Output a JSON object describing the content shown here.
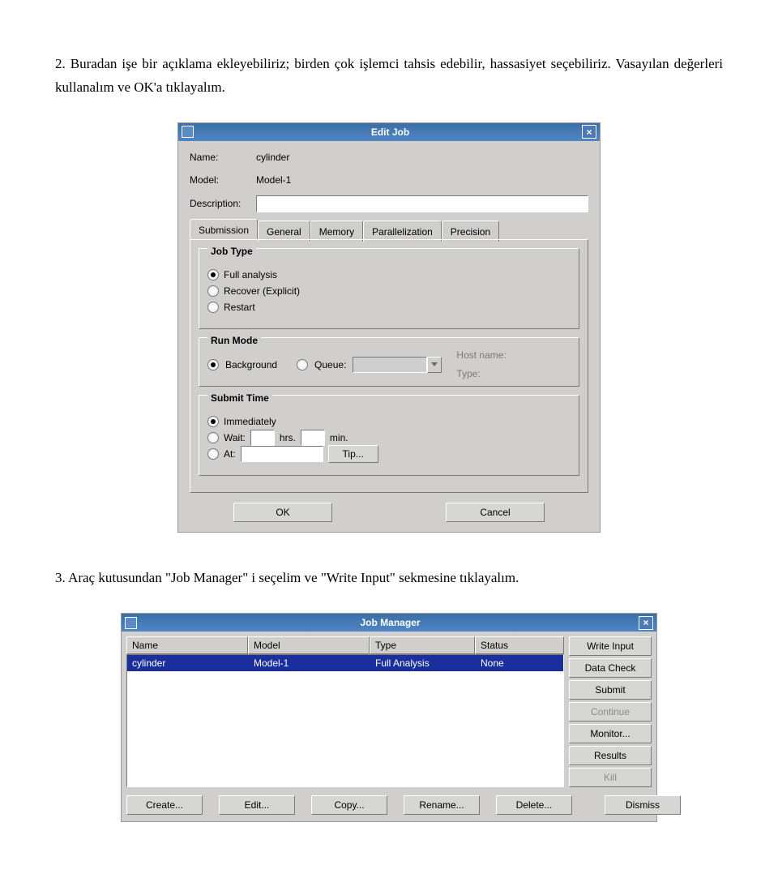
{
  "para1": "2. Buradan işe bir açıklama ekleyebiliriz; birden çok işlemci tahsis edebilir, hassasiyet seçebiliriz. Vasayılan değerleri kullanalım ve OK'a tıklayalım.",
  "para2": "3. Araç kutusundan \"Job Manager\" i seçelim ve \"Write Input\" sekmesine tıklayalım.",
  "editjob": {
    "title": "Edit Job",
    "name_lbl": "Name:",
    "name_val": "cylinder",
    "model_lbl": "Model:",
    "model_val": "Model-1",
    "desc_lbl": "Description:",
    "desc_val": "",
    "tabs": [
      "Submission",
      "General",
      "Memory",
      "Parallelization",
      "Precision"
    ],
    "jobtype": {
      "legend": "Job Type",
      "opt1": "Full analysis",
      "opt2": "Recover (Explicit)",
      "opt3": "Restart"
    },
    "runmode": {
      "legend": "Run Mode",
      "opt_bg": "Background",
      "opt_q": "Queue:",
      "host_lbl": "Host name:",
      "type_lbl": "Type:"
    },
    "submittime": {
      "legend": "Submit Time",
      "opt_imm": "Immediately",
      "opt_wait": "Wait:",
      "hrs": "hrs.",
      "min": "min.",
      "opt_at": "At:",
      "tip": "Tip..."
    },
    "ok": "OK",
    "cancel": "Cancel"
  },
  "jobmgr": {
    "title": "Job Manager",
    "cols": {
      "name": "Name",
      "model": "Model",
      "type": "Type",
      "status": "Status"
    },
    "row": {
      "name": "cylinder",
      "model": "Model-1",
      "type": "Full Analysis",
      "status": "None"
    },
    "buttons": {
      "write": "Write Input",
      "datacheck": "Data Check",
      "submit": "Submit",
      "continue": "Continue",
      "monitor": "Monitor...",
      "results": "Results",
      "kill": "Kill"
    },
    "bottom": {
      "create": "Create...",
      "edit": "Edit...",
      "copy": "Copy...",
      "rename": "Rename...",
      "delete": "Delete...",
      "dismiss": "Dismiss"
    }
  }
}
